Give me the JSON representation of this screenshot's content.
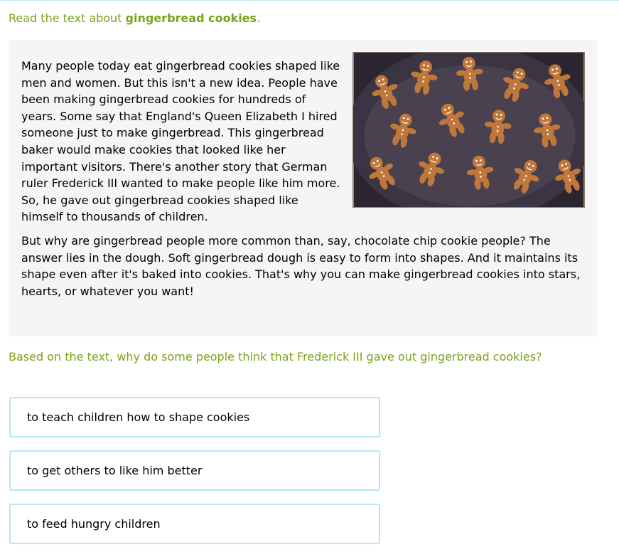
{
  "prompt": {
    "prefix": "Read the text about ",
    "bold": "gingerbread cookies",
    "suffix": "."
  },
  "passage": {
    "p1": "Many people today eat gingerbread cookies shaped like men and women. But this isn't a new idea. People have been making gingerbread cookies for hundreds of years. Some say that England's Queen Elizabeth I hired someone just to make gingerbread. This gingerbread baker would make cookies that looked like her important visitors. There's another story that German ruler Frederick III wanted to make people like him more. So, he gave out gingerbread cookies shaped like himself to thousands of children.",
    "p2": "But why are gingerbread people more common than, say, chocolate chip cookie people? The answer lies in the dough. Soft gingerbread dough is easy to form into shapes. And it maintains its shape even after it's baked into cookies. That's why you can make gingerbread cookies into stars, hearts, or whatever you want!"
  },
  "question": "Based on the text, why do some people think that Frederick III gave out gingerbread cookies?",
  "choices": [
    "to teach children how to shape cookies",
    "to get others to like him better",
    "to feed hungry children"
  ],
  "colors": {
    "accent": "#7ba21a",
    "choice_border": "#b6e7f2",
    "panel_bg": "#f5f5f5"
  }
}
